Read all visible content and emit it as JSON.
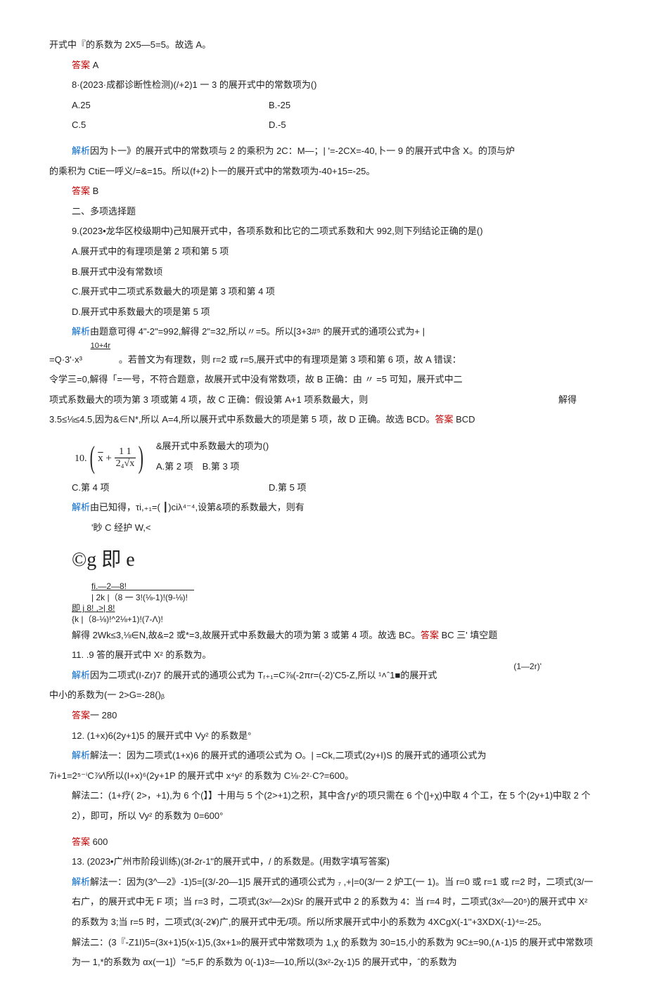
{
  "p1": "开式中『的系数为 2X5—5=5。故选 A。",
  "p2_a": "答案 ",
  "p2_b": "A",
  "p3": "8·(2023·成都诊断性检测)(/+2)1 一 3 的展开式中的常数项为()",
  "row1": {
    "a": "A.25",
    "b": "B.-25"
  },
  "row2": {
    "a": "C.5",
    "b": "D.-5"
  },
  "p6_a": "解析",
  "p6_b": "因为卜一》的展开式中的常数项与 2 的乘积为 2C：M—；| '=-2CX=-40,卜一 9 的展开式中含 X。的顶与炉",
  "p7": "的乘积为 CtiE一呼义/=&=15。所以(f+2)卜一的展开式中的常数项为-40+15=-25。",
  "p8_a": "答案 ",
  "p8_b": "B",
  "p9": "二、多项选择题",
  "p10": "9.(2023•龙华区校级期中)己知展开式中，各项系数和比它的二项式系数和大 992,则下列结论正确的是()",
  "p11": "A.展开式中的有理项是第 2 项和第 5 项",
  "p12": "B.展开式中没有常数顷",
  "p13": "C.展开式中二项式系数最大的项是第 3 项和第 4 项",
  "p14": "D.展开式中系数最大的项是第 5 项",
  "p15_a": "解析",
  "p15_b": "由题意可得 4\"-2\"=992,解得 2\"=32,所以〃=5。所以[3+3#⁵ 的展开式的通项公式为+ |",
  "p16_sup": "10+4r",
  "p16": "=Q·3'·x³    。若普文为有理数，则 r=2 或 r=5,展开式中的有理项是第 3 项和第 6 项，故 A 错误：",
  "p17": "令学三=0,解得「=一号，不符合题意，故展开式中没有常数项，故 B 正确：由 〃 =5 可知，展开式中二",
  "p18a": "项式系数最大的项为第 3 项或第 4 项，故 C 正确：假设第 A+1 项系数最大，则",
  "p18b": "解得",
  "p19a": "3.5≤⅛≤4.5,因为&∈N*,所以 A=4,所以展开式中系数最大的项是第 5 项，故 D 正确。故选 BCD。",
  "p19b": "答案 ",
  "p19c": "BCD",
  "p20_pre": "10.",
  "p20_inner_top": "√x +",
  "p20_inner_num": "1 1",
  "p20_inner_den": "2₄√x",
  "p20a": "&展开式中系数最大的项为()",
  "p20b": "A.第 2 项 B.第 3 项",
  "row3": {
    "a": "C.第 4 项",
    "b": "D.第 5 项"
  },
  "p22_a": "解析",
  "p22_b": "由已知得，τi,₊₁=( ┃)ciλ⁴⁻⁴,设第&项的系数最大，则有",
  "p23": "'眇 C 经护 W,<",
  "p24": "©g 即 e",
  "p25a": "fi.—2—8!        ",
  "p25b": "| 2k |（8 一 3!(⅛-1)!(9-⅛)!",
  "p25c": "即 j       8!      ,>|            8!",
  "p25d": "{k |（8-⅛)!^2⅛+1)!(7-Λ)!",
  "p26a": "解得 2Wk≤3,⅛∈N,故&=2 或*=3,故展开式中系数最大的项为第 3 或第 4 项。故选 BC。",
  "p26b": "答案 ",
  "p26c": "BC 三' 填空题",
  "p27": "11. .9 答的展开式中 X² 的系数为。",
  "p28_right": "(1—2r)'",
  "p28_a": "解析",
  "p28_b": "因为二项式(I-Zr)7 的展开式的通项公式为 Tᵣ₊₁=C⅞(-2πr=(-2)'C5-Z,所以 ¹˄ˆ1■的展开式",
  "p29": "中小的系数为(一 2>G=-28()ᵦ",
  "p30_a": "答案",
  "p30_b": "一 280",
  "p31": "12.   (1+x)6(2y+1)5 的展开式中 Vy² 的系数是°",
  "p32_a": "解析",
  "p32_b": "解法一：因为二项式(1+x)6 的展开式的通项公式为 O。| =Ck,二项式(2y+I)S 的展开式的通项公式为",
  "p33": "7i+1=2⁵⁻ⁱC⅞⁄\\所以(I+x)⁶(2y+1P 的展开式中 x⁴y² 的系数为 C⅛·2²·C?=600。",
  "p34": "解法二：(1+疗( 2>，+1),为 6 个(】】十用与 5 个(2>+1)之积，其中含ƒy²的项只需在 6 个(]+χ)中取 4 个工，在 5 个(2y+1)中取 2 个 2），即可，所以 Vy² 的系数为 0=600°",
  "p35_a": "答案 ",
  "p35_b": "600",
  "p36": "13.   (2023•广州市阶段训练)(3f-2r-1\"的展开式中，/ 的系数是。(用数字填写答案)",
  "p37_a": "解析",
  "p37_b": "解法一：因为(3^—2》-1)5=[(3/-20—1]5 展开式的通项公式为 ₇ ,+|=0(3/一 2 炉工(一 1)。当 r=0 或 r=1 或 r=2 时，二项式(3/一右广，的展开式中无 F 项；当 r=3 时，二项式(3x²—2x)Sr 的展开式中 2 的系数为 4：当 r=4 时，二项式(3x²—20⁵)的展开式中 X² 的系数为 3;当 r=5 时，二项式(3(-2¥)广,的展开式中无/项。所以所求展开式中小的系数为 4XCgX(-1''+3XDX(-1)⁴=-25。",
  "p38": "解法二：(3『-Z1I)5=(3x+1)5(x-1)5,(3x+1»的展开式中常数项为 1,χ 的系数为 30=15,小的系数为 9C±=90,(∧-1)5 的展开式中常数项为一 1,*的系数为 αx(一1]）″=5,F 的系数为 0(-1)3=—10,所以(3x²-2χ-1)5 的展开式中，ˆ的系数为"
}
